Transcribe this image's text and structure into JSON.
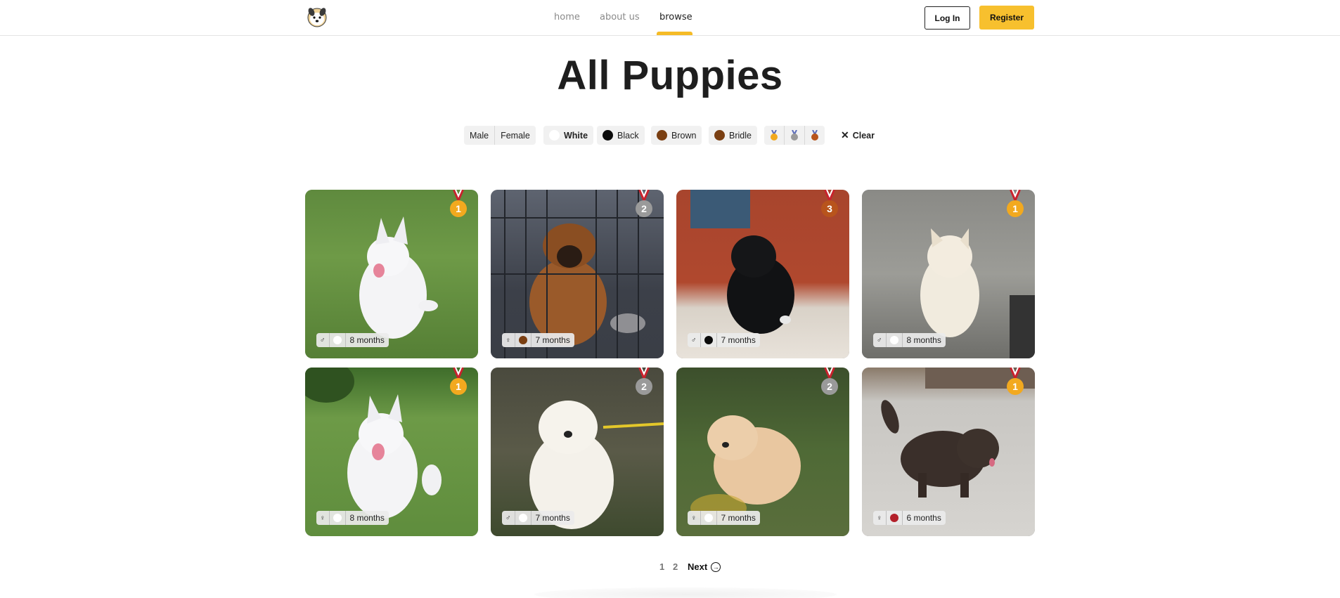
{
  "nav": {
    "items": [
      "home",
      "about us",
      "browse"
    ],
    "active": "browse"
  },
  "auth": {
    "login": "Log In",
    "register": "Register"
  },
  "page": {
    "title": "All Puppies"
  },
  "filters": {
    "sex": [
      "Male",
      "Female"
    ],
    "colors": [
      {
        "label": "White",
        "color": "#ffffff"
      },
      {
        "label": "Black",
        "color": "#0b0b0b"
      },
      {
        "label": "Brown",
        "color": "#7a3f12"
      },
      {
        "label": "Bridle",
        "color": "#7a3f12"
      }
    ],
    "medals": [
      "gold-medal-icon",
      "silver-medal-icon",
      "bronze-medal-icon"
    ],
    "clear": "Clear"
  },
  "puppies": [
    {
      "sex": "♂",
      "color": "#ffffff",
      "age": "8 months",
      "medal": "1",
      "medal_color": "#f2a91f"
    },
    {
      "sex": "♀",
      "color": "#7a3f12",
      "age": "7 months",
      "medal": "2",
      "medal_color": "#9a9a9a"
    },
    {
      "sex": "♂",
      "color": "#0b0b0b",
      "age": "7 months",
      "medal": "3",
      "medal_color": "#b8541c"
    },
    {
      "sex": "♂",
      "color": "#ffffff",
      "age": "8 months",
      "medal": "1",
      "medal_color": "#f2a91f"
    },
    {
      "sex": "♀",
      "color": "#ffffff",
      "age": "8 months",
      "medal": "1",
      "medal_color": "#f2a91f"
    },
    {
      "sex": "♂",
      "color": "#ffffff",
      "age": "7 months",
      "medal": "2",
      "medal_color": "#9a9a9a"
    },
    {
      "sex": "♀",
      "color": "#ffffff",
      "age": "7 months",
      "medal": "2",
      "medal_color": "#9a9a9a"
    },
    {
      "sex": "♀",
      "color": "#b3202a",
      "age": "6 months",
      "medal": "1",
      "medal_color": "#f2a91f"
    }
  ],
  "pagination": {
    "pages": [
      "1",
      "2"
    ],
    "next": "Next"
  }
}
